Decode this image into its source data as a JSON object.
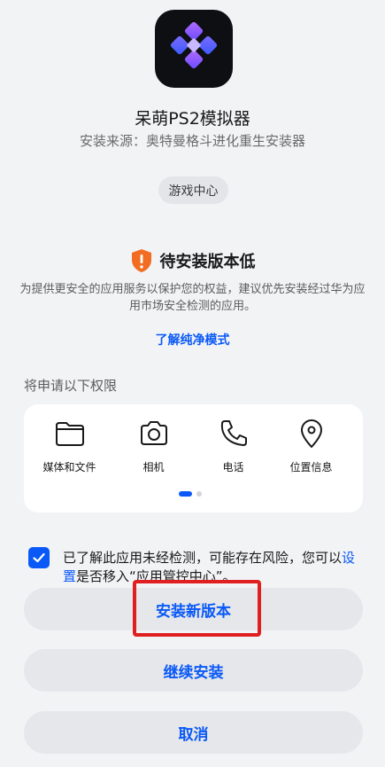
{
  "app": {
    "name": "呆萌PS2模拟器",
    "source": "安装来源：奥特曼格斗进化重生安装器",
    "category": "游戏中心",
    "icon": "ps2-emulator-app-icon"
  },
  "warning": {
    "icon": "shield-warning-icon",
    "title": "待安装版本低",
    "description": "为提供更安全的应用服务以保护您的权益，建议优先安装经过华为应用市场安全检测的应用。",
    "link": "了解纯净模式"
  },
  "permissions": {
    "heading": "将申请以下权限",
    "items": [
      {
        "label": "媒体和文件",
        "icon": "folder-icon"
      },
      {
        "label": "相机",
        "icon": "camera-icon"
      },
      {
        "label": "电话",
        "icon": "phone-icon"
      },
      {
        "label": "位置信息",
        "icon": "location-icon"
      }
    ],
    "page_count": 2,
    "current_page": 1
  },
  "consent": {
    "checked": true,
    "text_before": "已了解此应用未经检测，可能存在风险，您可以",
    "link": "设置",
    "text_after": "是否移入“应用管控中心”。"
  },
  "buttons": {
    "install_new": "安装新版本",
    "continue": "继续安装",
    "cancel": "取消"
  },
  "colors": {
    "accent": "#0a59f7",
    "warning": "#f26d21",
    "highlight": "#e02020",
    "background": "#f1f3f5"
  }
}
